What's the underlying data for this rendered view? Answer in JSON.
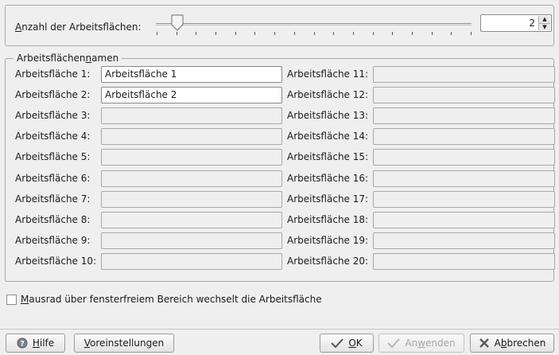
{
  "workspace_count": {
    "label": "Anzahl der Arbeitsflächen:",
    "label_mnemonic": "A",
    "label_rest": "nzahl der Arbeitsflächen:",
    "value": "2",
    "slider_fraction": 0.05
  },
  "names_group": {
    "legend_prefix": "Arbeitsflächen",
    "legend_mnemonic": "n",
    "legend_suffix": "amen",
    "left": [
      {
        "label": "Arbeitsfläche 1:",
        "value": "Arbeitsfläche 1"
      },
      {
        "label": "Arbeitsfläche 2:",
        "value": "Arbeitsfläche 2"
      },
      {
        "label": "Arbeitsfläche 3:",
        "value": ""
      },
      {
        "label": "Arbeitsfläche 4:",
        "value": ""
      },
      {
        "label": "Arbeitsfläche 5:",
        "value": ""
      },
      {
        "label": "Arbeitsfläche 6:",
        "value": ""
      },
      {
        "label": "Arbeitsfläche 7:",
        "value": ""
      },
      {
        "label": "Arbeitsfläche 8:",
        "value": ""
      },
      {
        "label": "Arbeitsfläche 9:",
        "value": ""
      },
      {
        "label": "Arbeitsfläche 10:",
        "value": ""
      }
    ],
    "right": [
      {
        "label": "Arbeitsfläche 11:",
        "value": ""
      },
      {
        "label": "Arbeitsfläche 12:",
        "value": ""
      },
      {
        "label": "Arbeitsfläche 13:",
        "value": ""
      },
      {
        "label": "Arbeitsfläche 14:",
        "value": ""
      },
      {
        "label": "Arbeitsfläche 15:",
        "value": ""
      },
      {
        "label": "Arbeitsfläche 16:",
        "value": ""
      },
      {
        "label": "Arbeitsfläche 17:",
        "value": ""
      },
      {
        "label": "Arbeitsfläche 18:",
        "value": ""
      },
      {
        "label": "Arbeitsfläche 19:",
        "value": ""
      },
      {
        "label": "Arbeitsfläche 20:",
        "value": ""
      }
    ]
  },
  "mouse_wheel": {
    "mnemonic": "M",
    "label_rest": "ausrad über fensterfreiem Bereich wechselt die Arbeitsfläche",
    "checked": false
  },
  "buttons": {
    "help": {
      "mnemonic": "H",
      "rest": "ilfe",
      "icon": "help-icon"
    },
    "defaults": {
      "mnemonic": "V",
      "rest": "oreinstellungen"
    },
    "ok": {
      "mnemonic": "O",
      "rest": "K",
      "icon": "checkmark-icon"
    },
    "apply": {
      "prefix": "An",
      "mnemonic": "w",
      "rest": "enden",
      "icon": "checkmark-icon",
      "enabled": false
    },
    "cancel": {
      "prefix": "A",
      "mnemonic": "b",
      "rest": "brechen",
      "icon": "cross-icon"
    }
  }
}
